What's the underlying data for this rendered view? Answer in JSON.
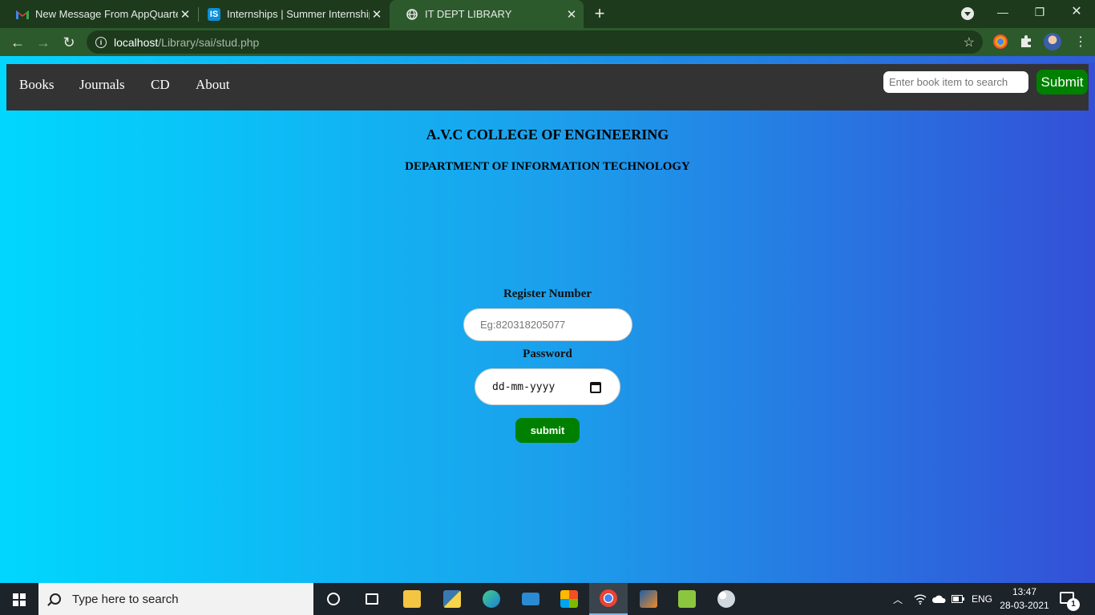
{
  "browser": {
    "tabs": [
      {
        "title": "New Message From AppQuarterz",
        "icon": "gmail-icon",
        "active": false
      },
      {
        "title": "Internships | Summer Internship 2",
        "icon": "internshala-icon",
        "active": false
      },
      {
        "title": "IT DEPT LIBRARY",
        "icon": "globe-icon",
        "active": true
      }
    ],
    "url_host": "localhost",
    "url_path": "/Library/sai/stud.php"
  },
  "navbar": {
    "links": [
      "Books",
      "Journals",
      "CD",
      "About"
    ],
    "search_placeholder": "Enter book item to search",
    "submit_label": "Submit"
  },
  "header": {
    "college": "A.V.C COLLEGE OF ENGINEERING",
    "department": "DEPARTMENT OF INFORMATION TECHNOLOGY"
  },
  "form": {
    "register_label": "Register Number",
    "register_placeholder": "Eg:820318205077",
    "password_label": "Password",
    "date_placeholder": "dd-mm-yyyy",
    "submit_label": "submit"
  },
  "taskbar": {
    "search_placeholder": "Type here to search",
    "language": "ENG",
    "time": "13:47",
    "date": "28-03-2021",
    "notification_count": "1"
  },
  "colors": {
    "gradient_start": "#00d7fe",
    "gradient_end": "#3350d7",
    "navbar_bg": "#333333",
    "button_green": "#008000"
  }
}
